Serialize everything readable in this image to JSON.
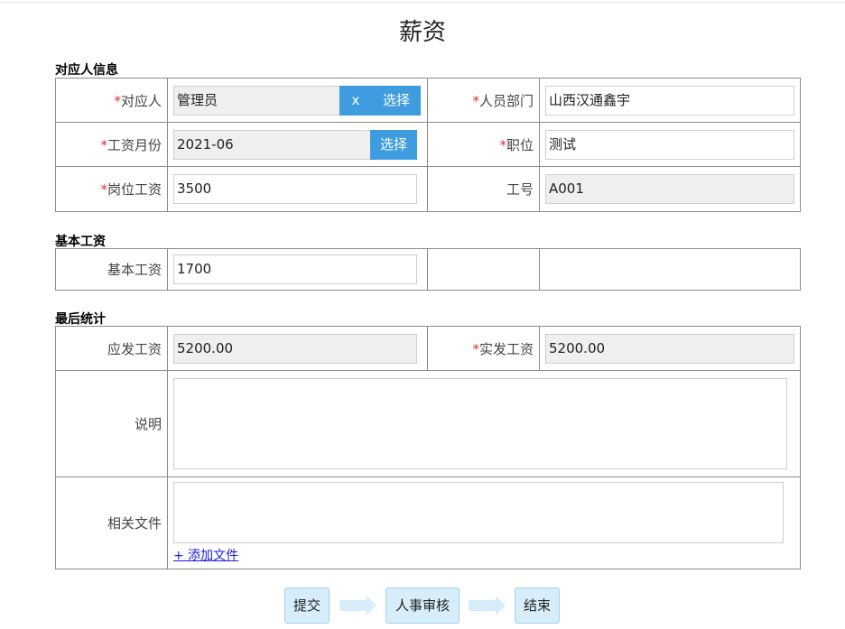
{
  "page": {
    "title": "薪资"
  },
  "sections": {
    "info": "对应人信息",
    "base": "基本工资",
    "final": "最后统计"
  },
  "info": {
    "person": {
      "label": "对应人",
      "value": "管理员",
      "clear_label": "x",
      "select_label": "选择"
    },
    "department": {
      "label": "人员部门",
      "value": "山西汉通鑫宇"
    },
    "month": {
      "label": "工资月份",
      "value": "2021-06",
      "select_label": "选择"
    },
    "position": {
      "label": "职位",
      "value": "测试"
    },
    "post_salary": {
      "label": "岗位工资",
      "value": "3500"
    },
    "employee_id": {
      "label": "工号",
      "value": "A001"
    }
  },
  "base": {
    "base_salary": {
      "label": "基本工资",
      "value": "1700"
    }
  },
  "final": {
    "payable": {
      "label": "应发工资",
      "value": "5200.00"
    },
    "actual": {
      "label": "实发工资",
      "value": "5200.00"
    },
    "remark": {
      "label": "说明",
      "value": ""
    },
    "files": {
      "label": "相关文件",
      "add_label": "+ 添加文件"
    }
  },
  "required_mark": "*",
  "flow": {
    "steps": [
      "提交",
      "人事审核",
      "结束"
    ]
  },
  "colors": {
    "accent": "#3f9ddf",
    "required": "#e03030",
    "flow_fill": "#d7edf9",
    "link": "#1a1adb"
  }
}
